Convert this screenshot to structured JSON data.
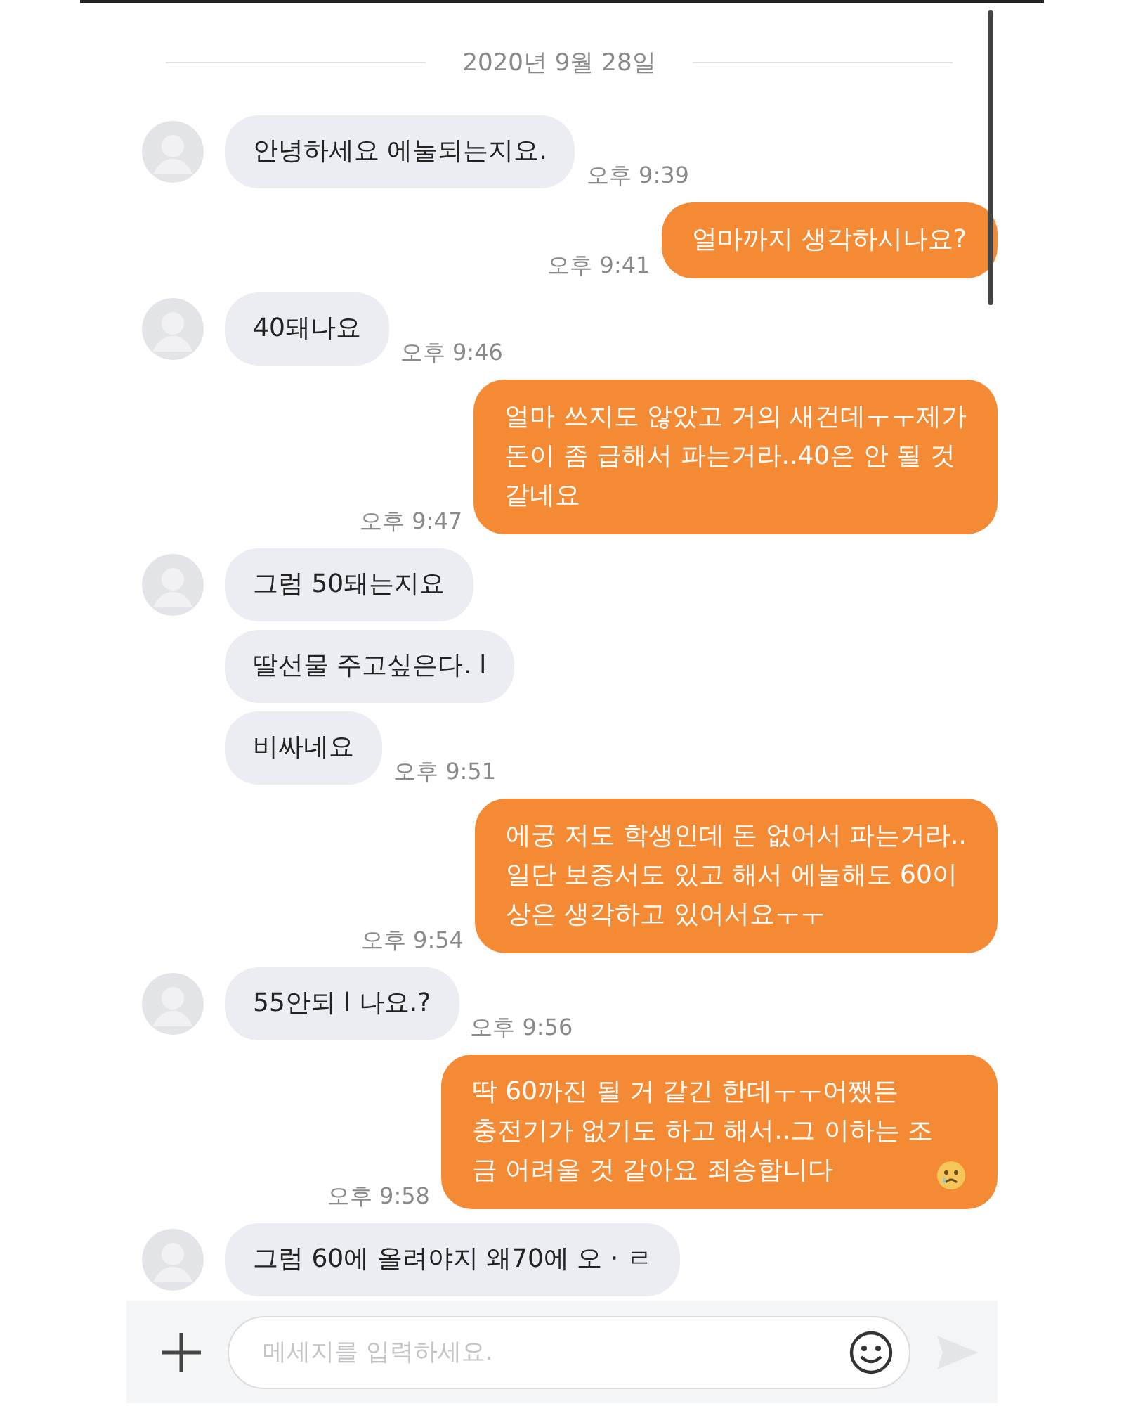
{
  "date": "2020년 9월 28일",
  "messages": [
    {
      "kind": "received",
      "avatar": true,
      "text": "안녕하세요 에눌되는지요.",
      "time": "오후 9:39"
    },
    {
      "kind": "sent",
      "text": "얼마까지 생각하시나요?",
      "time": "오후 9:41"
    },
    {
      "kind": "received",
      "avatar": true,
      "text": "40돼나요",
      "time": "오후 9:46"
    },
    {
      "kind": "sent",
      "text": "얼마 쓰지도 않았고 거의 새건데ㅜㅜ제가\n돈이 좀 급해서 파는거라..40은 안 될 것\n같네요",
      "time": "오후 9:47"
    },
    {
      "kind": "received",
      "avatar": true,
      "text": "그럼 50돼는지요"
    },
    {
      "kind": "received",
      "avatar": false,
      "text": "딸선물 주고싶은다. l"
    },
    {
      "kind": "received",
      "avatar": false,
      "text": "비싸네요",
      "time": "오후 9:51"
    },
    {
      "kind": "sent",
      "text": "에궁 저도 학생인데 돈 없어서 파는거라..\n일단 보증서도 있고 해서 에눌해도 60이\n상은 생각하고 있어서요ㅜㅜ",
      "time": "오후 9:54"
    },
    {
      "kind": "received",
      "avatar": true,
      "text": "55안되 l 나요.?",
      "time": "오후 9:56"
    },
    {
      "kind": "sent",
      "text": "딱 60까진 될 거 같긴 한데ㅜㅜ어쨌든\n충전기가 없기도 하고 해서..그 이하는 조\n금 어려울 것 같아요 죄송합니다",
      "crying_emoji": true,
      "time": "오후 9:58"
    },
    {
      "kind": "received",
      "avatar": true,
      "text": "그럼 60에 올려야지 왜70에 오 · ㄹ"
    }
  ],
  "composer": {
    "placeholder": "메세지를 입력하세요."
  }
}
